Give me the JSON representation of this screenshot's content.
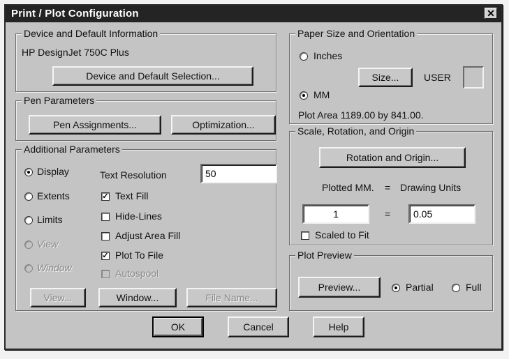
{
  "window": {
    "title": "Print / Plot Configuration",
    "close_glyph": "✕"
  },
  "device": {
    "group_label": "Device and Default Information",
    "device_name": "HP DesignJet 750C Plus",
    "selection_button": "Device and Default Selection..."
  },
  "pen": {
    "group_label": "Pen Parameters",
    "assignments_button": "Pen Assignments...",
    "optimization_button": "Optimization..."
  },
  "additional": {
    "group_label": "Additional Parameters",
    "area_options": [
      {
        "label": "Display",
        "checked": true,
        "enabled": true
      },
      {
        "label": "Extents",
        "checked": false,
        "enabled": true
      },
      {
        "label": "Limits",
        "checked": false,
        "enabled": true
      },
      {
        "label": "View",
        "checked": false,
        "enabled": false
      },
      {
        "label": "Window",
        "checked": false,
        "enabled": false
      }
    ],
    "text_resolution_label": "Text Resolution",
    "text_resolution_value": "50",
    "checkboxes": [
      {
        "label": "Text Fill",
        "checked": true,
        "enabled": true
      },
      {
        "label": "Hide-Lines",
        "checked": false,
        "enabled": true
      },
      {
        "label": "Adjust Area Fill",
        "checked": false,
        "enabled": true
      },
      {
        "label": "Plot To File",
        "checked": true,
        "enabled": true
      },
      {
        "label": "Autospool",
        "checked": false,
        "enabled": false
      }
    ],
    "view_button": "View...",
    "window_button": "Window...",
    "file_name_button": "File Name..."
  },
  "paper": {
    "group_label": "Paper Size and Orientation",
    "inches_label": "Inches",
    "inches_checked": false,
    "mm_label": "MM",
    "mm_checked": true,
    "size_button": "Size...",
    "size_name": "USER",
    "plot_area": "Plot Area 1189.00 by 841.00."
  },
  "scale": {
    "group_label": "Scale, Rotation, and Origin",
    "rotation_button": "Rotation and Origin...",
    "plotted_label": "Plotted MM.",
    "equals": "=",
    "drawing_units_label": "Drawing Units",
    "plotted_value": "1",
    "drawing_value": "0.05",
    "scaled_to_fit_label": "Scaled to Fit",
    "scaled_to_fit_checked": false
  },
  "preview": {
    "group_label": "Plot Preview",
    "preview_button": "Preview...",
    "partial_label": "Partial",
    "partial_checked": true,
    "full_label": "Full",
    "full_checked": false
  },
  "footer": {
    "ok_button": "OK",
    "cancel_button": "Cancel",
    "help_button": "Help"
  },
  "colors": {
    "dialog_bg": "#c4c4c4",
    "titlebar_bg": "#242424",
    "titlebar_text": "#ffffff"
  }
}
